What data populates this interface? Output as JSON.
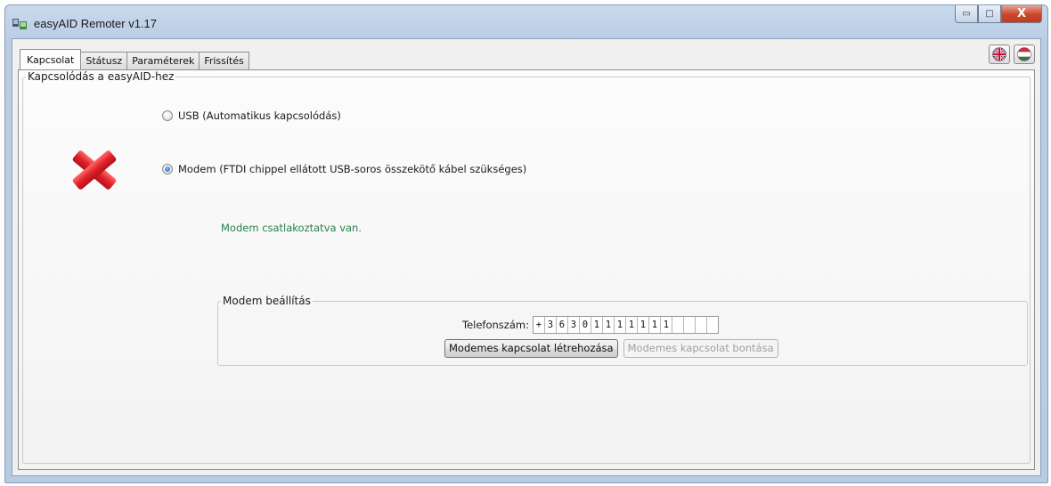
{
  "window": {
    "title": "easyAID Remoter v1.17",
    "controls": {
      "minimize": "▭",
      "maximize": "□",
      "close": "X"
    }
  },
  "tabs": [
    {
      "label": "Kapcsolat",
      "active": true
    },
    {
      "label": "Státusz",
      "active": false
    },
    {
      "label": "Paraméterek",
      "active": false
    },
    {
      "label": "Frissítés",
      "active": false
    }
  ],
  "language_buttons": [
    {
      "icon": "uk-flag-icon"
    },
    {
      "icon": "hungary-flag-icon"
    }
  ],
  "connection_group": {
    "legend": "Kapcsolódás a easyAID-hez",
    "status_icon": "red-x-icon",
    "options": [
      {
        "label": "USB (Automatikus kapcsolódás)",
        "checked": false
      },
      {
        "label": "Modem (FTDI chippel ellátott USB-soros összekötő kábel szükséges)",
        "checked": true
      }
    ],
    "status_message": "Modem csatlakoztatva van."
  },
  "modem_settings": {
    "legend": "Modem beállítás",
    "phone_label": "Telefonszám:",
    "phone_digits": [
      "+",
      "3",
      "6",
      "3",
      "0",
      "1",
      "1",
      "1",
      "1",
      "1",
      "1",
      "1",
      "",
      "",
      "",
      ""
    ],
    "connect_button": "Modemes kapcsolat létrehozása",
    "disconnect_button": "Modemes kapcsolat bontása"
  },
  "colors": {
    "status_green": "#2a7f45",
    "error_red": "#e0212b",
    "title_bar": "#c9d9ec"
  }
}
